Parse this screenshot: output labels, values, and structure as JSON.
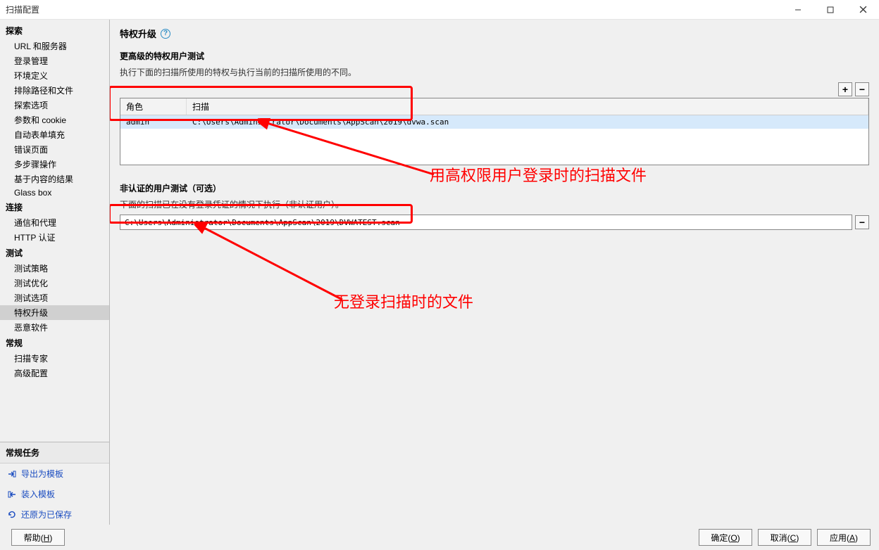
{
  "window": {
    "title": "扫描配置"
  },
  "sidebar": {
    "groups": [
      {
        "label": "探索",
        "items": [
          "URL 和服务器",
          "登录管理",
          "环境定义",
          "排除路径和文件",
          "探索选项",
          "参数和 cookie",
          "自动表单填充",
          "错误页面",
          "多步骤操作",
          "基于内容的结果",
          "Glass box"
        ]
      },
      {
        "label": "连接",
        "items": [
          "通信和代理",
          "HTTP 认证"
        ]
      },
      {
        "label": "测试",
        "items": [
          "测试策略",
          "测试优化",
          "测试选项",
          "特权升级",
          "恶意软件"
        ]
      },
      {
        "label": "常规",
        "items": [
          "扫描专家",
          "高级配置"
        ]
      }
    ],
    "selected": "特权升级",
    "tasks": {
      "header": "常规任务",
      "items": [
        "导出为模板",
        "装入模板",
        "还原为已保存"
      ]
    }
  },
  "content": {
    "page_title": "特权升级",
    "section1": {
      "title": "更高级的特权用户测试",
      "desc": "执行下面的扫描所使用的特权与执行当前的扫描所使用的不同。",
      "columns": {
        "role": "角色",
        "scan": "扫描"
      },
      "rows": [
        {
          "role": "admin",
          "scan": "C:\\Users\\Administrator\\Documents\\AppScan\\2019\\dvwa.scan"
        }
      ]
    },
    "section2": {
      "title": "非认证的用户测试（可选）",
      "desc": "下面的扫描已在没有登录凭证的情况下执行（非认证用户）。",
      "path": "C:\\Users\\Administrator\\Documents\\AppScan\\2019\\DVWATEST.scan"
    },
    "annotations": {
      "a1": "用高权限用户登录时的扫描文件",
      "a2": "无登录扫描时的文件"
    }
  },
  "footer": {
    "help": "帮助(H)",
    "ok": "确定(O)",
    "cancel": "取消(C)",
    "apply": "应用(A)"
  },
  "icons": {
    "plus": "+",
    "minus": "−",
    "help": "?"
  }
}
